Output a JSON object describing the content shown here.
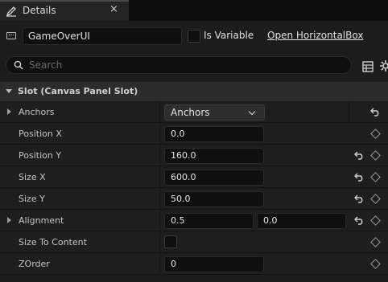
{
  "tab": {
    "title": "Details",
    "close": "×"
  },
  "header": {
    "widget_name": "GameOverUI",
    "is_variable_label": "Is Variable",
    "open_link": "Open HorizontalBox"
  },
  "search": {
    "placeholder": "Search"
  },
  "section": {
    "title": "Slot (Canvas Panel Slot)"
  },
  "rows": {
    "anchors": {
      "label": "Anchors",
      "value": "Anchors"
    },
    "position_x": {
      "label": "Position X",
      "value": "0.0"
    },
    "position_y": {
      "label": "Position Y",
      "value": "160.0"
    },
    "size_x": {
      "label": "Size X",
      "value": "600.0"
    },
    "size_y": {
      "label": "Size Y",
      "value": "50.0"
    },
    "alignment": {
      "label": "Alignment",
      "x": "0.5",
      "y": "0.0"
    },
    "size_to_content": {
      "label": "Size To Content",
      "checked": false
    },
    "zorder": {
      "label": "ZOrder",
      "value": "0"
    }
  },
  "colors": {
    "background": "#1c1c1c",
    "section": "#2c2c2c",
    "field": "#0f0f0f",
    "text": "#c4c4c4"
  },
  "icons": [
    "pencil-icon",
    "close-icon",
    "widget-icon",
    "search-icon",
    "grid-icon",
    "gear-icon",
    "expand-arrow-icon",
    "chevron-down-icon",
    "reset-icon",
    "keyframe-diamond-icon"
  ]
}
